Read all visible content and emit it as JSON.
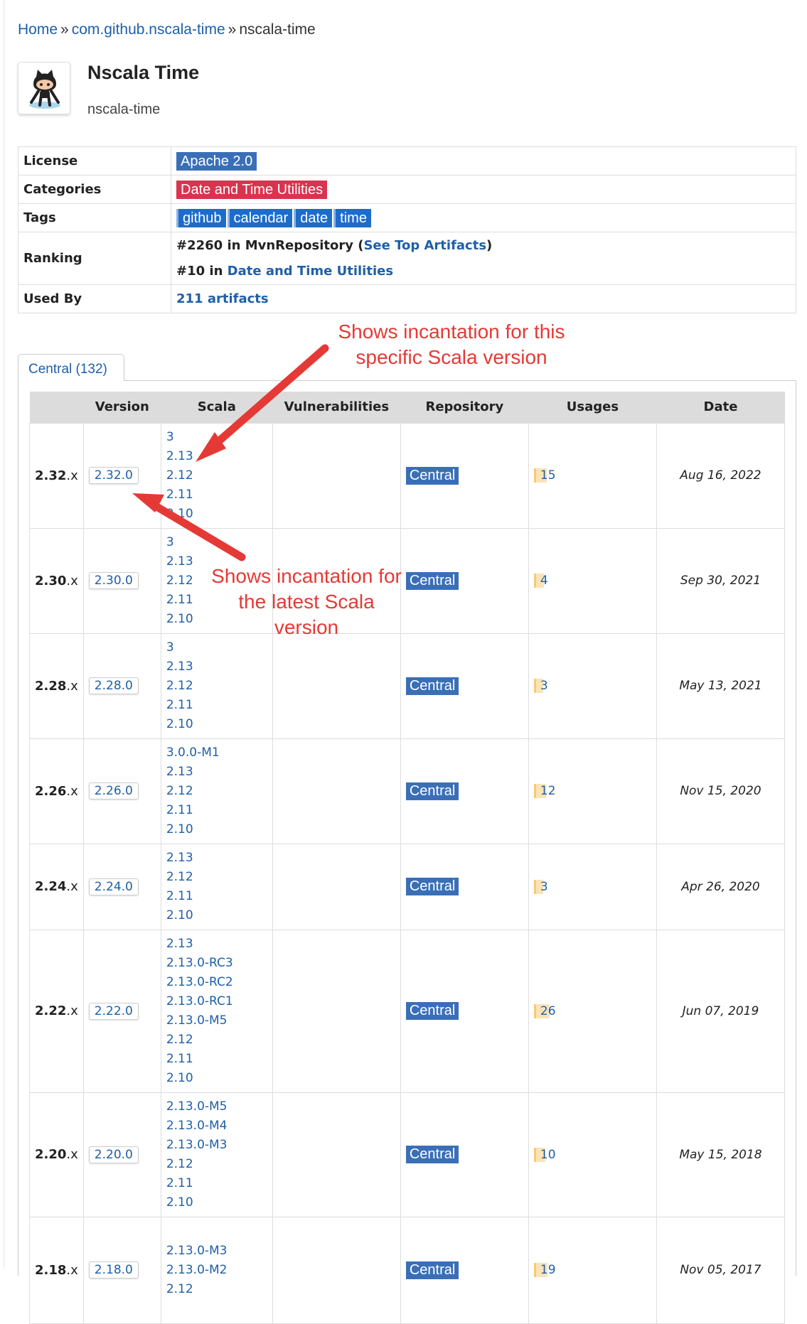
{
  "breadcrumb": {
    "home": "Home",
    "sep1": "»",
    "group": "com.github.nscala-time",
    "sep2": "»",
    "current": "nscala-time"
  },
  "header": {
    "title": "Nscala Time",
    "subtitle": "nscala-time",
    "logo_icon": "github-octocat-icon"
  },
  "info": {
    "license_label": "License",
    "license_value": "Apache 2.0",
    "categories_label": "Categories",
    "category_value": "Date and Time Utilities",
    "tags_label": "Tags",
    "tags": [
      "github",
      "calendar",
      "date",
      "time"
    ],
    "ranking_label": "Ranking",
    "rank1_prefix": "#2260 in MvnRepository (",
    "rank1_link": "See Top Artifacts",
    "rank1_suffix": ")",
    "rank2_prefix": "#10 in ",
    "rank2_link": "Date and Time Utilities",
    "usedby_label": "Used By",
    "usedby_value": "211 artifacts"
  },
  "tab": {
    "label": "Central (132)"
  },
  "table": {
    "headers": [
      "",
      "Version",
      "Scala",
      "Vulnerabilities",
      "Repository",
      "Usages",
      "Date"
    ],
    "rows": [
      {
        "major": "2.32",
        "ver": "2.32.0",
        "scala": [
          "3",
          "2.13",
          "2.12",
          "2.11",
          "2.10"
        ],
        "repo": "Central",
        "usages": "15",
        "usage_level": 0.58,
        "date": "Aug 16, 2022"
      },
      {
        "major": "2.30",
        "ver": "2.30.0",
        "scala": [
          "3",
          "2.13",
          "2.12",
          "2.11",
          "2.10"
        ],
        "repo": "Central",
        "usages": "4",
        "usage_level": 0.15,
        "date": "Sep 30, 2021"
      },
      {
        "major": "2.28",
        "ver": "2.28.0",
        "scala": [
          "3",
          "2.13",
          "2.12",
          "2.11",
          "2.10"
        ],
        "repo": "Central",
        "usages": "3",
        "usage_level": 0.12,
        "date": "May 13, 2021"
      },
      {
        "major": "2.26",
        "ver": "2.26.0",
        "scala": [
          "3.0.0-M1",
          "2.13",
          "2.12",
          "2.11",
          "2.10"
        ],
        "repo": "Central",
        "usages": "12",
        "usage_level": 0.46,
        "date": "Nov 15, 2020"
      },
      {
        "major": "2.24",
        "ver": "2.24.0",
        "scala": [
          "2.13",
          "2.12",
          "2.11",
          "2.10"
        ],
        "repo": "Central",
        "usages": "3",
        "usage_level": 0.12,
        "date": "Apr 26, 2020"
      },
      {
        "major": "2.22",
        "ver": "2.22.0",
        "scala": [
          "2.13",
          "2.13.0-RC3",
          "2.13.0-RC2",
          "2.13.0-RC1",
          "2.13.0-M5",
          "2.12",
          "2.11",
          "2.10"
        ],
        "repo": "Central",
        "usages": "26",
        "usage_level": 1.0,
        "date": "Jun 07, 2019"
      },
      {
        "major": "2.20",
        "ver": "2.20.0",
        "scala": [
          "2.13.0-M5",
          "2.13.0-M4",
          "2.13.0-M3",
          "2.12",
          "2.11",
          "2.10"
        ],
        "repo": "Central",
        "usages": "10",
        "usage_level": 0.38,
        "date": "May 15, 2018"
      },
      {
        "major": "2.18",
        "ver": "2.18.0",
        "scala": [
          "2.13.0-M3",
          "2.13.0-M2",
          "2.12"
        ],
        "repo": "Central",
        "usages": "19",
        "usage_level": 0.73,
        "date": "Nov 05, 2017"
      }
    ]
  },
  "annotations": {
    "specific": "Shows incantation for this specific Scala version",
    "latest": "Shows incantation for the latest Scala version"
  },
  "colors": {
    "link": "#1f5fa8",
    "annotation": "#e53935",
    "central_badge": "#3a6fb7",
    "category_badge": "#d9344f"
  }
}
